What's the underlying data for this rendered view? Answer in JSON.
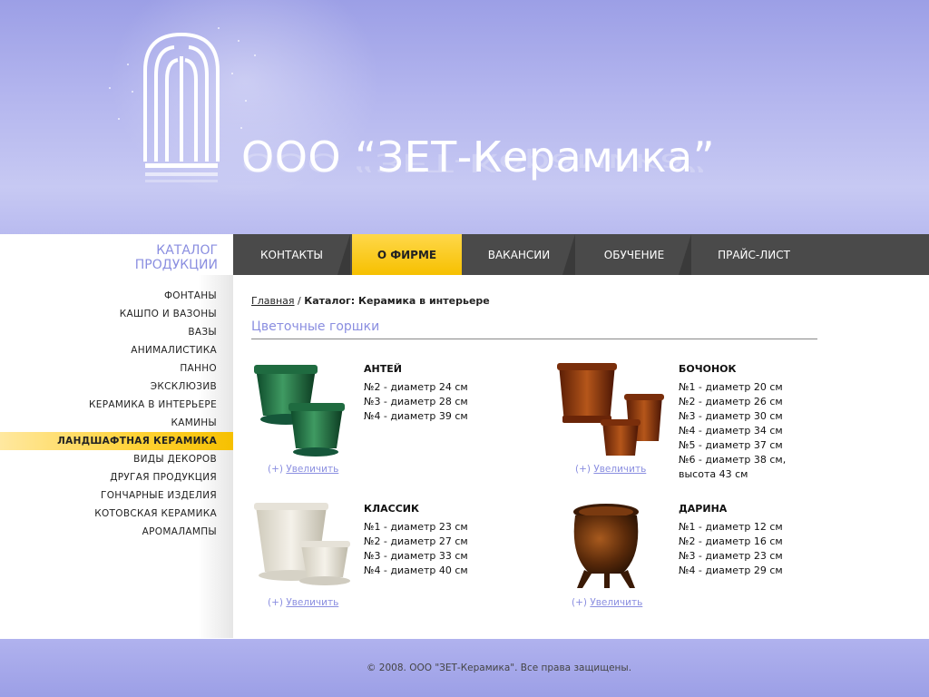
{
  "header": {
    "brand": "ООО “ЗЕТ-Керамика”"
  },
  "catalog": {
    "title_line1": "КАТАЛОГ",
    "title_line2": "ПРОДУКЦИИ"
  },
  "nav": {
    "items": [
      {
        "label": "КОНТАКТЫ"
      },
      {
        "label": "О ФИРМЕ"
      },
      {
        "label": "ВАКАНСИИ"
      },
      {
        "label": "ОБУЧЕНИЕ"
      },
      {
        "label": "ПРАЙС-ЛИСТ"
      }
    ]
  },
  "sidebar": {
    "items": [
      {
        "label": "ФОНТАНЫ"
      },
      {
        "label": "КАШПО И ВАЗОНЫ"
      },
      {
        "label": "ВАЗЫ"
      },
      {
        "label": "АНИМАЛИСТИКА"
      },
      {
        "label": "ПАННО"
      },
      {
        "label": "ЭКСКЛЮЗИВ"
      },
      {
        "label": "КЕРАМИКА В ИНТЕРЬЕРЕ"
      },
      {
        "label": "КАМИНЫ"
      },
      {
        "label": "ЛАНДШАФТНАЯ КЕРАМИКА"
      },
      {
        "label": "ВИДЫ ДЕКОРОВ"
      },
      {
        "label": "ДРУГАЯ ПРОДУКЦИЯ"
      },
      {
        "label": "ГОНЧАРНЫЕ ИЗДЕЛИЯ"
      },
      {
        "label": "КОТОВСКАЯ КЕРАМИКА"
      },
      {
        "label": "АРОМАЛАМПЫ"
      }
    ]
  },
  "breadcrumb": {
    "home": "Главная",
    "separator": " / ",
    "current": "Каталог: Керамика в интерьере"
  },
  "page_title": "Цветочные горшки",
  "zoom": {
    "prefix": "(+)",
    "label": "Увеличить"
  },
  "products": [
    {
      "name": "АНТЕЙ",
      "specs": [
        "№2 - диаметр 24 см",
        "№3 - диаметр 28 см",
        "№4 - диаметр 39 см"
      ]
    },
    {
      "name": "БОЧОНОК",
      "specs": [
        "№1 - диаметр 20 см",
        "№2 - диаметр 26 см",
        "№3 - диаметр 30 см",
        "№4 - диаметр 34 см",
        "№5 - диаметр 37 см",
        "№6 - диаметр 38 см,",
        "высота 43 см"
      ]
    },
    {
      "name": "КЛАССИК",
      "specs": [
        "№1 - диаметр 23 см",
        "№2 - диаметр 27 см",
        "№3 - диаметр 33 см",
        "№4 - диаметр 40 см"
      ]
    },
    {
      "name": "ДАРИНА",
      "specs": [
        "№1 - диаметр 12 см",
        "№2 - диаметр 16 см",
        "№3 - диаметр 23 см",
        "№4 - диаметр 29 см"
      ]
    }
  ],
  "footer": {
    "text": "© 2008. ООО \"ЗЕТ-Керамика\". Все права защищены."
  },
  "colors": {
    "accent": "#8a8ee0",
    "active_nav": "#ffcc00",
    "nav_bg": "#4a4a4a",
    "header_bg": "#b3b5ee"
  }
}
